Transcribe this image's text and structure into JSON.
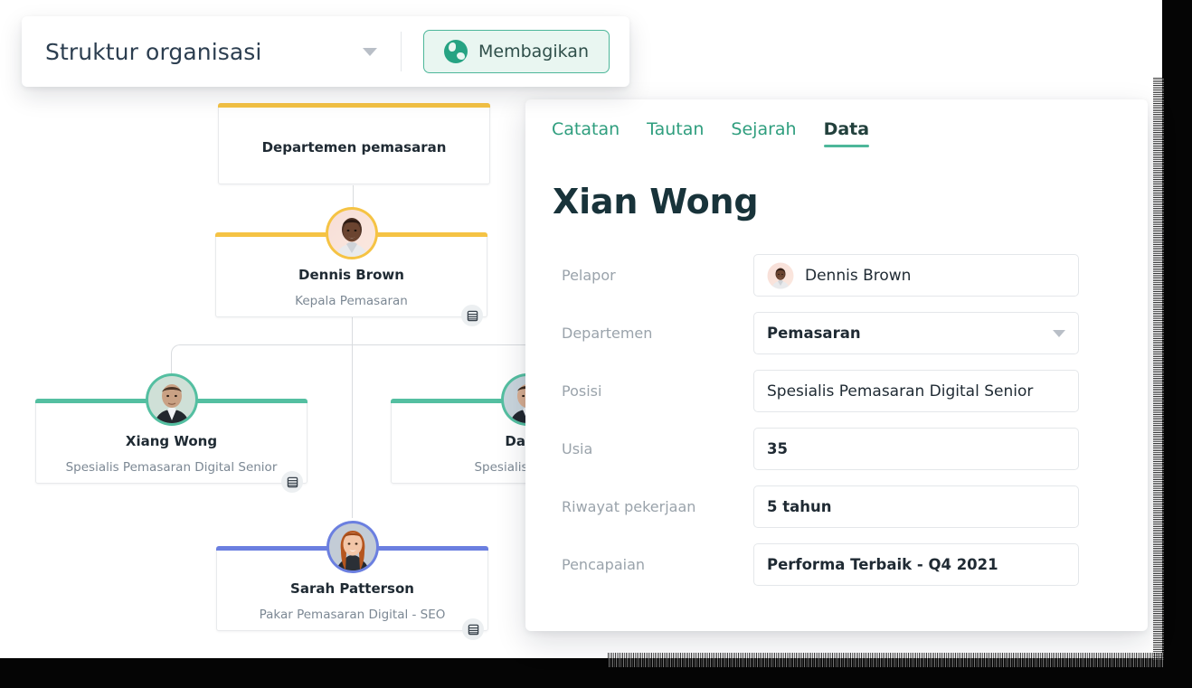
{
  "toolbar": {
    "title": "Struktur organisasi",
    "dropdown_icon": "chevron-down-icon",
    "share_label": "Membagikan",
    "share_icon": "globe-icon"
  },
  "chart": {
    "department_node": {
      "title": "Departemen pemasaran",
      "accent": "#F5C344"
    },
    "nodes": [
      {
        "name": "Dennis Brown",
        "role": "Kepala Pemasaran",
        "accent": "#F5C344",
        "badge_icon": "database-icon"
      },
      {
        "name": "Xiang Wong",
        "role": "Spesialis Pemasaran Digital Senior",
        "accent": "#54BFA1",
        "badge_icon": "database-icon"
      },
      {
        "name": "David",
        "role": "Spesialis Pemasa",
        "accent": "#54BFA1",
        "badge_icon": "database-icon"
      },
      {
        "name": "Sarah Patterson",
        "role": "Pakar Pemasaran Digital - SEO",
        "accent": "#6B7FE0",
        "badge_icon": "database-icon"
      }
    ]
  },
  "panel": {
    "tabs": [
      {
        "label": "Catatan",
        "active": false
      },
      {
        "label": "Tautan",
        "active": false
      },
      {
        "label": "Sejarah",
        "active": false
      },
      {
        "label": "Data",
        "active": true
      }
    ],
    "person_name": "Xian Wong",
    "fields": [
      {
        "label": "Pelapor",
        "value": "Dennis Brown",
        "type": "avatar"
      },
      {
        "label": "Departemen",
        "value": "Pemasaran",
        "type": "select"
      },
      {
        "label": "Posisi",
        "value": "Spesialis Pemasaran Digital Senior",
        "type": "text"
      },
      {
        "label": "Usia",
        "value": "35",
        "type": "text"
      },
      {
        "label": "Riwayat pekerjaan",
        "value": "5 tahun",
        "type": "text"
      },
      {
        "label": "Pencapaian",
        "value": "Performa Terbaik - Q4 2021",
        "type": "text"
      }
    ]
  },
  "colors": {
    "brand_green": "#2f9e7e",
    "accent_yellow": "#F5C344",
    "accent_teal": "#54BFA1",
    "accent_blue": "#6B7FE0",
    "text_dark": "#1f2a33",
    "text_muted": "#9aa3ab"
  }
}
